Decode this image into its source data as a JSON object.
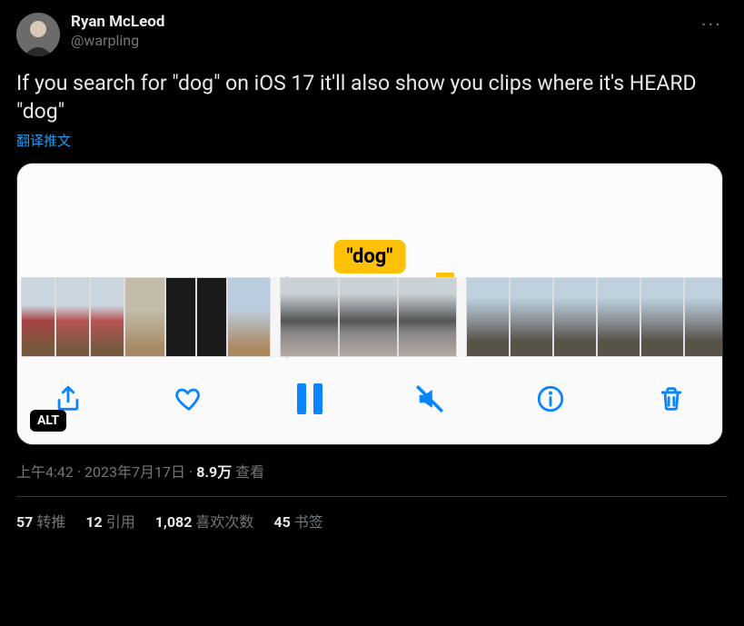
{
  "author": {
    "display_name": "Ryan McLeod",
    "handle": "@warpling"
  },
  "tweet_text": "If you search for \"dog\" on iOS 17 it'll also show you clips where it's HEARD \"dog\"",
  "translate_label": "翻译推文",
  "media": {
    "dog_badge": "\"dog\"",
    "alt_badge": "ALT"
  },
  "timestamp": {
    "time": "上午4:42",
    "date": "2023年7月17日",
    "views_num": "8.9万",
    "views_label": "查看"
  },
  "stats": {
    "retweets": {
      "num": "57",
      "label": "转推"
    },
    "quotes": {
      "num": "12",
      "label": "引用"
    },
    "likes": {
      "num": "1,082",
      "label": "喜欢次数"
    },
    "bookmarks": {
      "num": "45",
      "label": "书签"
    }
  },
  "more_label": "···"
}
